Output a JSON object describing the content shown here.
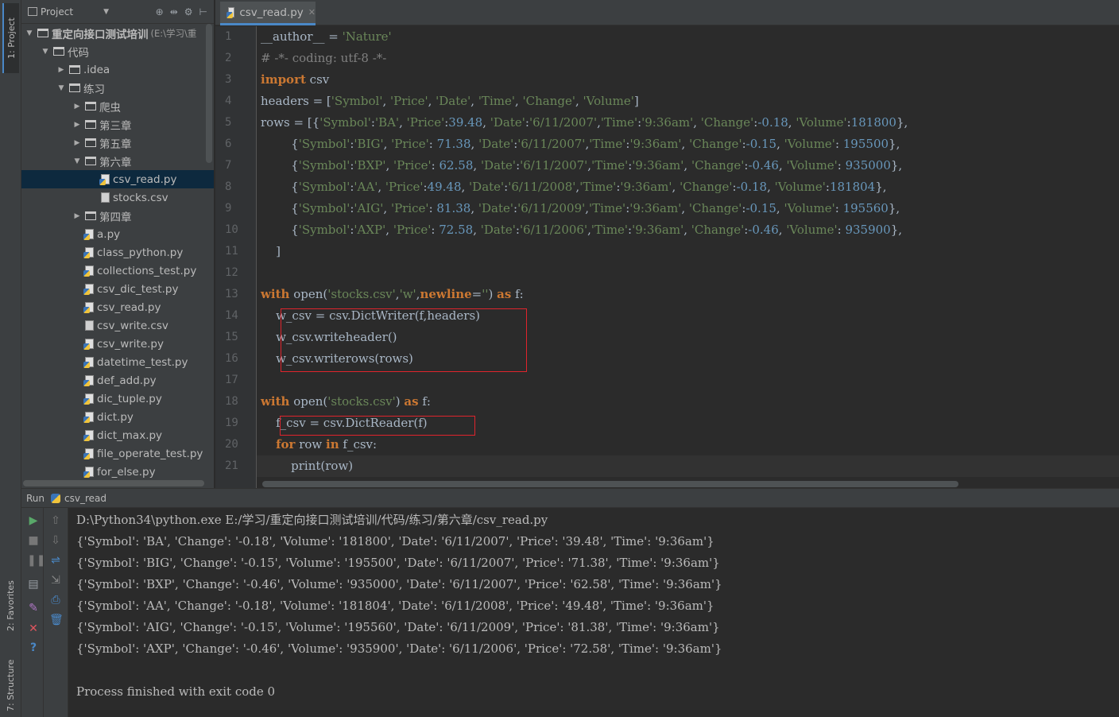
{
  "left_strip": {
    "project_tab": "1: Project",
    "favorites_tab": "2: Favorites",
    "structure_tab": "7: Structure"
  },
  "project_panel": {
    "title": "Project",
    "tree": [
      {
        "label": "重定向接口测试培训",
        "sub": "(E:\\学习\\重",
        "type": "folder",
        "indent": 0,
        "arrow": "▼",
        "bold": true
      },
      {
        "label": "代码",
        "type": "folder",
        "indent": 1,
        "arrow": "▼"
      },
      {
        "label": ".idea",
        "type": "folder",
        "indent": 2,
        "arrow": "▶"
      },
      {
        "label": "练习",
        "type": "folder",
        "indent": 2,
        "arrow": "▼"
      },
      {
        "label": "爬虫",
        "type": "folder",
        "indent": 3,
        "arrow": "▶"
      },
      {
        "label": "第三章",
        "type": "folder",
        "indent": 3,
        "arrow": "▶"
      },
      {
        "label": "第五章",
        "type": "folder",
        "indent": 3,
        "arrow": "▶"
      },
      {
        "label": "第六章",
        "type": "folder",
        "indent": 3,
        "arrow": "▼"
      },
      {
        "label": "csv_read.py",
        "type": "py",
        "indent": 4,
        "arrow": "",
        "selected": true
      },
      {
        "label": "stocks.csv",
        "type": "csv",
        "indent": 4,
        "arrow": ""
      },
      {
        "label": "第四章",
        "type": "folder",
        "indent": 3,
        "arrow": "▶"
      },
      {
        "label": "a.py",
        "type": "py",
        "indent": 3,
        "arrow": ""
      },
      {
        "label": "class_python.py",
        "type": "py",
        "indent": 3,
        "arrow": ""
      },
      {
        "label": "collections_test.py",
        "type": "py",
        "indent": 3,
        "arrow": ""
      },
      {
        "label": "csv_dic_test.py",
        "type": "py",
        "indent": 3,
        "arrow": ""
      },
      {
        "label": "csv_read.py",
        "type": "py",
        "indent": 3,
        "arrow": ""
      },
      {
        "label": "csv_write.csv",
        "type": "csv",
        "indent": 3,
        "arrow": ""
      },
      {
        "label": "csv_write.py",
        "type": "py",
        "indent": 3,
        "arrow": ""
      },
      {
        "label": "datetime_test.py",
        "type": "py",
        "indent": 3,
        "arrow": ""
      },
      {
        "label": "def_add.py",
        "type": "py",
        "indent": 3,
        "arrow": ""
      },
      {
        "label": "dic_tuple.py",
        "type": "py",
        "indent": 3,
        "arrow": ""
      },
      {
        "label": "dict.py",
        "type": "py",
        "indent": 3,
        "arrow": ""
      },
      {
        "label": "dict_max.py",
        "type": "py",
        "indent": 3,
        "arrow": ""
      },
      {
        "label": "file_operate_test.py",
        "type": "py",
        "indent": 3,
        "arrow": ""
      },
      {
        "label": "for_else.py",
        "type": "py",
        "indent": 3,
        "arrow": ""
      }
    ]
  },
  "editor": {
    "tab_label": "csv_read.py",
    "line_numbers": [
      "1",
      "2",
      "3",
      "4",
      "5",
      "6",
      "7",
      "8",
      "9",
      "10",
      "11",
      "12",
      "13",
      "14",
      "15",
      "16",
      "17",
      "18",
      "19",
      "20",
      "21"
    ],
    "lines": [
      [
        [
          "dunder",
          "__author__"
        ],
        [
          "p",
          " = "
        ],
        [
          "str",
          "'Nature'"
        ]
      ],
      [
        [
          "cm",
          "# -*- coding: utf-8 -*-"
        ]
      ],
      [
        [
          "kw",
          "import"
        ],
        [
          "p",
          " csv"
        ]
      ],
      [
        [
          "p",
          "headers = ["
        ],
        [
          "str",
          "'Symbol'"
        ],
        [
          "p",
          ", "
        ],
        [
          "str",
          "'Price'"
        ],
        [
          "p",
          ", "
        ],
        [
          "str",
          "'Date'"
        ],
        [
          "p",
          ", "
        ],
        [
          "str",
          "'Time'"
        ],
        [
          "p",
          ", "
        ],
        [
          "str",
          "'Change'"
        ],
        [
          "p",
          ", "
        ],
        [
          "str",
          "'Volume'"
        ],
        [
          "p",
          "]"
        ]
      ],
      [
        [
          "p",
          "rows = [{"
        ],
        [
          "str",
          "'Symbol'"
        ],
        [
          "p",
          ":"
        ],
        [
          "str",
          "'BA'"
        ],
        [
          "p",
          ", "
        ],
        [
          "str",
          "'Price'"
        ],
        [
          "p",
          ":"
        ],
        [
          "num",
          "39.48"
        ],
        [
          "p",
          ", "
        ],
        [
          "str",
          "'Date'"
        ],
        [
          "p",
          ":"
        ],
        [
          "str",
          "'6/11/2007'"
        ],
        [
          "p",
          ","
        ],
        [
          "str",
          "'Time'"
        ],
        [
          "p",
          ":"
        ],
        [
          "str",
          "'9:36am'"
        ],
        [
          "p",
          ", "
        ],
        [
          "str",
          "'Change'"
        ],
        [
          "p",
          ":"
        ],
        [
          "num",
          "-0.18"
        ],
        [
          "p",
          ", "
        ],
        [
          "str",
          "'Volume'"
        ],
        [
          "p",
          ":"
        ],
        [
          "num",
          "181800"
        ],
        [
          "p",
          "},"
        ]
      ],
      [
        [
          "p",
          "        {"
        ],
        [
          "str",
          "'Symbol'"
        ],
        [
          "p",
          ":"
        ],
        [
          "str",
          "'BIG'"
        ],
        [
          "p",
          ", "
        ],
        [
          "str",
          "'Price'"
        ],
        [
          "p",
          ": "
        ],
        [
          "num",
          "71.38"
        ],
        [
          "p",
          ", "
        ],
        [
          "str",
          "'Date'"
        ],
        [
          "p",
          ":"
        ],
        [
          "str",
          "'6/11/2007'"
        ],
        [
          "p",
          ","
        ],
        [
          "str",
          "'Time'"
        ],
        [
          "p",
          ":"
        ],
        [
          "str",
          "'9:36am'"
        ],
        [
          "p",
          ", "
        ],
        [
          "str",
          "'Change'"
        ],
        [
          "p",
          ":"
        ],
        [
          "num",
          "-0.15"
        ],
        [
          "p",
          ", "
        ],
        [
          "str",
          "'Volume'"
        ],
        [
          "p",
          ": "
        ],
        [
          "num",
          "195500"
        ],
        [
          "p",
          "},"
        ]
      ],
      [
        [
          "p",
          "        {"
        ],
        [
          "str",
          "'Symbol'"
        ],
        [
          "p",
          ":"
        ],
        [
          "str",
          "'BXP'"
        ],
        [
          "p",
          ", "
        ],
        [
          "str",
          "'Price'"
        ],
        [
          "p",
          ": "
        ],
        [
          "num",
          "62.58"
        ],
        [
          "p",
          ", "
        ],
        [
          "str",
          "'Date'"
        ],
        [
          "p",
          ":"
        ],
        [
          "str",
          "'6/11/2007'"
        ],
        [
          "p",
          ","
        ],
        [
          "str",
          "'Time'"
        ],
        [
          "p",
          ":"
        ],
        [
          "str",
          "'9:36am'"
        ],
        [
          "p",
          ", "
        ],
        [
          "str",
          "'Change'"
        ],
        [
          "p",
          ":"
        ],
        [
          "num",
          "-0.46"
        ],
        [
          "p",
          ", "
        ],
        [
          "str",
          "'Volume'"
        ],
        [
          "p",
          ": "
        ],
        [
          "num",
          "935000"
        ],
        [
          "p",
          "},"
        ]
      ],
      [
        [
          "p",
          "        {"
        ],
        [
          "str",
          "'Symbol'"
        ],
        [
          "p",
          ":"
        ],
        [
          "str",
          "'AA'"
        ],
        [
          "p",
          ", "
        ],
        [
          "str",
          "'Price'"
        ],
        [
          "p",
          ":"
        ],
        [
          "num",
          "49.48"
        ],
        [
          "p",
          ", "
        ],
        [
          "str",
          "'Date'"
        ],
        [
          "p",
          ":"
        ],
        [
          "str",
          "'6/11/2008'"
        ],
        [
          "p",
          ","
        ],
        [
          "str",
          "'Time'"
        ],
        [
          "p",
          ":"
        ],
        [
          "str",
          "'9:36am'"
        ],
        [
          "p",
          ", "
        ],
        [
          "str",
          "'Change'"
        ],
        [
          "p",
          ":"
        ],
        [
          "num",
          "-0.18"
        ],
        [
          "p",
          ", "
        ],
        [
          "str",
          "'Volume'"
        ],
        [
          "p",
          ":"
        ],
        [
          "num",
          "181804"
        ],
        [
          "p",
          "},"
        ]
      ],
      [
        [
          "p",
          "        {"
        ],
        [
          "str",
          "'Symbol'"
        ],
        [
          "p",
          ":"
        ],
        [
          "str",
          "'AIG'"
        ],
        [
          "p",
          ", "
        ],
        [
          "str",
          "'Price'"
        ],
        [
          "p",
          ": "
        ],
        [
          "num",
          "81.38"
        ],
        [
          "p",
          ", "
        ],
        [
          "str",
          "'Date'"
        ],
        [
          "p",
          ":"
        ],
        [
          "str",
          "'6/11/2009'"
        ],
        [
          "p",
          ","
        ],
        [
          "str",
          "'Time'"
        ],
        [
          "p",
          ":"
        ],
        [
          "str",
          "'9:36am'"
        ],
        [
          "p",
          ", "
        ],
        [
          "str",
          "'Change'"
        ],
        [
          "p",
          ":"
        ],
        [
          "num",
          "-0.15"
        ],
        [
          "p",
          ", "
        ],
        [
          "str",
          "'Volume'"
        ],
        [
          "p",
          ": "
        ],
        [
          "num",
          "195560"
        ],
        [
          "p",
          "},"
        ]
      ],
      [
        [
          "p",
          "        {"
        ],
        [
          "str",
          "'Symbol'"
        ],
        [
          "p",
          ":"
        ],
        [
          "str",
          "'AXP'"
        ],
        [
          "p",
          ", "
        ],
        [
          "str",
          "'Price'"
        ],
        [
          "p",
          ": "
        ],
        [
          "num",
          "72.58"
        ],
        [
          "p",
          ", "
        ],
        [
          "str",
          "'Date'"
        ],
        [
          "p",
          ":"
        ],
        [
          "str",
          "'6/11/2006'"
        ],
        [
          "p",
          ","
        ],
        [
          "str",
          "'Time'"
        ],
        [
          "p",
          ":"
        ],
        [
          "str",
          "'9:36am'"
        ],
        [
          "p",
          ", "
        ],
        [
          "str",
          "'Change'"
        ],
        [
          "p",
          ":"
        ],
        [
          "num",
          "-0.46"
        ],
        [
          "p",
          ", "
        ],
        [
          "str",
          "'Volume'"
        ],
        [
          "p",
          ": "
        ],
        [
          "num",
          "935900"
        ],
        [
          "p",
          "},"
        ]
      ],
      [
        [
          "p",
          "    ]"
        ]
      ],
      [
        [
          "p",
          ""
        ]
      ],
      [
        [
          "kw",
          "with"
        ],
        [
          "p",
          " open("
        ],
        [
          "str",
          "'stocks.csv'"
        ],
        [
          "p",
          ","
        ],
        [
          "str",
          "'w'"
        ],
        [
          "p",
          ","
        ],
        [
          "kw",
          "newline"
        ],
        [
          "p",
          "="
        ],
        [
          "str",
          "''"
        ],
        [
          "p",
          ") "
        ],
        [
          "kw",
          "as"
        ],
        [
          "p",
          " f:"
        ]
      ],
      [
        [
          "p",
          "    w_csv = csv.DictWriter(f,headers)"
        ]
      ],
      [
        [
          "p",
          "    w_csv.writeheader()"
        ]
      ],
      [
        [
          "p",
          "    w_csv.writerows(rows)"
        ]
      ],
      [
        [
          "p",
          ""
        ]
      ],
      [
        [
          "kw",
          "with"
        ],
        [
          "p",
          " open("
        ],
        [
          "str",
          "'stocks.csv'"
        ],
        [
          "p",
          ") "
        ],
        [
          "kw",
          "as"
        ],
        [
          "p",
          " f:"
        ]
      ],
      [
        [
          "p",
          "    f_csv = csv.DictReader(f)"
        ]
      ],
      [
        [
          "p",
          "    "
        ],
        [
          "kw",
          "for"
        ],
        [
          "p",
          " row "
        ],
        [
          "kw",
          "in"
        ],
        [
          "p",
          " f_csv:"
        ]
      ],
      [
        [
          "p",
          "        print(row)"
        ]
      ]
    ]
  },
  "run_panel": {
    "label": "Run",
    "config": "csv_read",
    "output": [
      "D:\\Python34\\python.exe E:/学习/重定向接口测试培训/代码/练习/第六章/csv_read.py",
      "{'Symbol': 'BA', 'Change': '-0.18', 'Volume': '181800', 'Date': '6/11/2007', 'Price': '39.48', 'Time': '9:36am'}",
      "{'Symbol': 'BIG', 'Change': '-0.15', 'Volume': '195500', 'Date': '6/11/2007', 'Price': '71.38', 'Time': '9:36am'}",
      "{'Symbol': 'BXP', 'Change': '-0.46', 'Volume': '935000', 'Date': '6/11/2007', 'Price': '62.58', 'Time': '9:36am'}",
      "{'Symbol': 'AA', 'Change': '-0.18', 'Volume': '181804', 'Date': '6/11/2008', 'Price': '49.48', 'Time': '9:36am'}",
      "{'Symbol': 'AIG', 'Change': '-0.15', 'Volume': '195560', 'Date': '6/11/2009', 'Price': '81.38', 'Time': '9:36am'}",
      "{'Symbol': 'AXP', 'Change': '-0.46', 'Volume': '935900', 'Date': '6/11/2006', 'Price': '72.58', 'Time': '9:36am'}",
      "",
      "Process finished with exit code 0"
    ]
  },
  "icons": [
    "project-icon",
    "folder-icon",
    "python-file-icon",
    "csv-file-icon",
    "run-icon",
    "stop-icon",
    "pause-icon",
    "close-icon",
    "help-icon",
    "star-icon"
  ],
  "colors": {
    "keyword": "#cc7832",
    "string": "#6a8759",
    "number": "#6897bb",
    "comment": "#808080",
    "highlight_box": "#e0242c",
    "selection": "#0d293e",
    "accent": "#4a88c7"
  }
}
